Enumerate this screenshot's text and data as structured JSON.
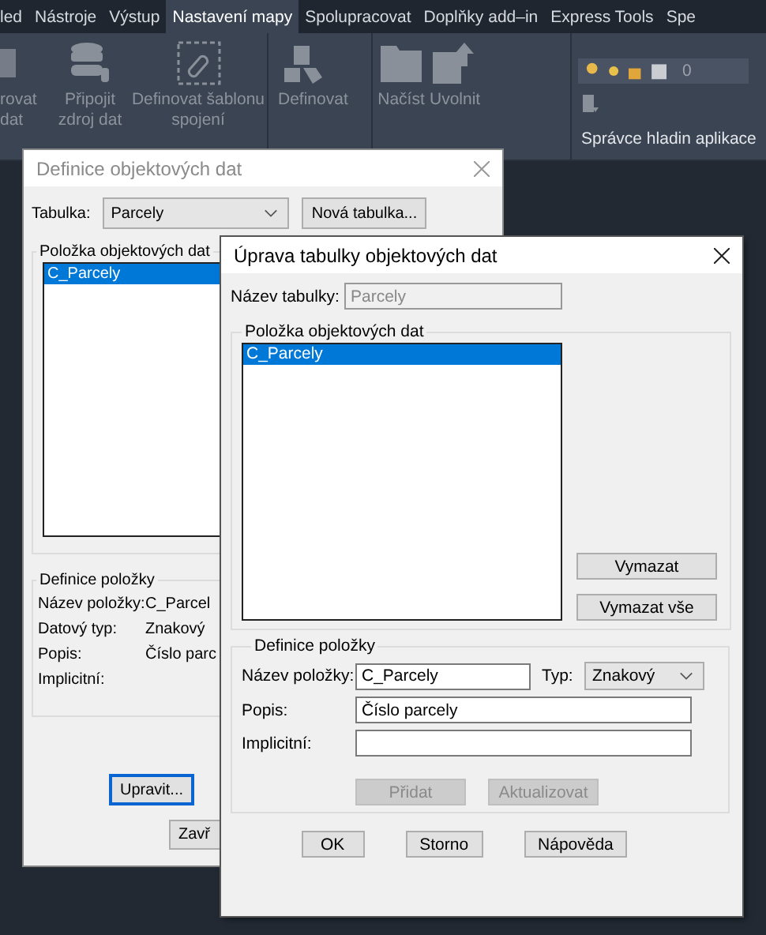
{
  "ribbon": {
    "tabs": [
      {
        "label": "led",
        "selected": false
      },
      {
        "label": "Nástroje",
        "selected": false
      },
      {
        "label": "Výstup",
        "selected": false
      },
      {
        "label": "Nastavení mapy",
        "selected": true
      },
      {
        "label": "Spolupracovat",
        "selected": false
      },
      {
        "label": "Doplňky add–in",
        "selected": false
      },
      {
        "label": "Express Tools",
        "selected": false
      },
      {
        "label": "Spe",
        "selected": false
      }
    ],
    "tools": [
      {
        "kind": "cut",
        "lines": [
          "rovat",
          "dat"
        ]
      },
      {
        "kind": "database",
        "lines": [
          "Připojit",
          "zdroj dat"
        ]
      },
      {
        "kind": "template",
        "lines": [
          "Definovat šablonu",
          "spojení"
        ]
      },
      {
        "kind": "cube",
        "lines": [
          "Definovat"
        ]
      },
      {
        "kind": "folder",
        "lines": [
          "Načíst"
        ]
      },
      {
        "kind": "map",
        "lines": [
          "Uvolnit"
        ]
      }
    ],
    "layer_panel": {
      "layer": "0",
      "title": "Správce hladin aplikace"
    }
  },
  "back_dialog": {
    "title": "Definice objektových dat",
    "table_label": "Tabulka:",
    "table_value": "Parcely",
    "new_table_button": "Nová tabulka...",
    "items_group": "Položka objektových dat",
    "items": [
      {
        "label": "C_Parcely",
        "selected": true
      }
    ],
    "def_group": "Definice položky",
    "fields": [
      {
        "label": "Název položky:",
        "value": "C_Parcel"
      },
      {
        "label": "Datový typ:",
        "value": "Znakový"
      },
      {
        "label": "Popis:",
        "value": "Číslo parc"
      },
      {
        "label": "Implicitní:"
      }
    ],
    "edit_button": {
      "label": "Upravit...",
      "focused": true
    },
    "close_button": "Zavř"
  },
  "edit_dialog": {
    "title": "Úprava tabulky objektových dat",
    "name_label": "Název tabulky:",
    "name_value": "Parcely",
    "items_group": "Položka objektových dat",
    "items": [
      {
        "label": "C_Parcely",
        "selected": true
      }
    ],
    "delete_button": "Vymazat",
    "delete_all_button": "Vymazat vše",
    "def_group": "Definice položky",
    "item_name_label": "Název položky:",
    "item_name_value": "C_Parcely",
    "type_label": "Typ:",
    "type_value": "Znakový",
    "desc_label": "Popis:",
    "desc_value": "Číslo parcely",
    "default_label": "Implicitní:",
    "action_buttons": [
      {
        "label": "Přidat",
        "disabled": true
      },
      {
        "label": "Aktualizovat",
        "disabled": true
      }
    ],
    "footer_buttons": [
      {
        "label": "OK",
        "disabled": false
      },
      {
        "label": "Storno",
        "disabled": false
      },
      {
        "label": "Nápověda",
        "disabled": false
      }
    ]
  }
}
